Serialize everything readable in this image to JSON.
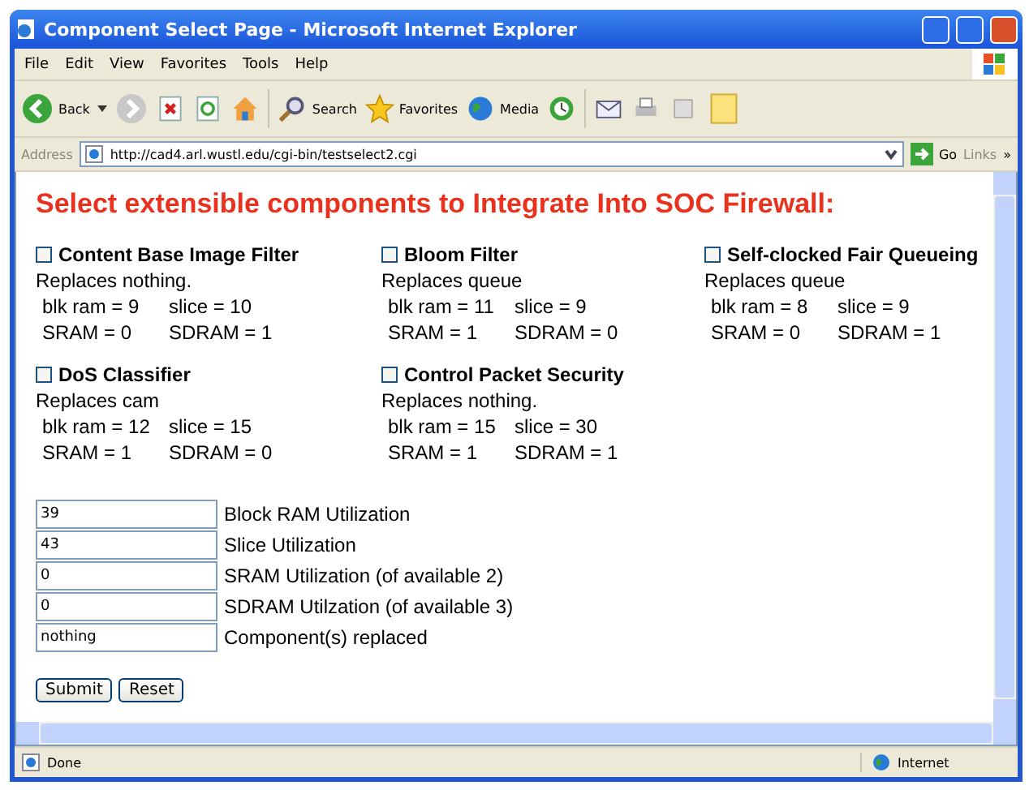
{
  "window": {
    "title": "Component Select Page - Microsoft Internet Explorer"
  },
  "menu": [
    "File",
    "Edit",
    "View",
    "Favorites",
    "Tools",
    "Help"
  ],
  "toolbar": {
    "back": "Back",
    "search": "Search",
    "favorites": "Favorites",
    "media": "Media"
  },
  "address_bar": {
    "label": "Address",
    "url": "http://cad4.arl.wustl.edu/cgi-bin/testselect2.cgi",
    "go": "Go",
    "links": "Links",
    "more": "»"
  },
  "heading": "Select extensible components to Integrate Into SOC Firewall:",
  "components": [
    {
      "name": "Content Base Image Filter",
      "checked": false,
      "replaces": "Replaces nothing.",
      "blk_ram": "blk ram = 9",
      "slice": "slice = 10",
      "sram": "SRAM = 0",
      "sdram": "SDRAM = 1"
    },
    {
      "name": "Bloom Filter",
      "checked": false,
      "replaces": "Replaces queue",
      "blk_ram": "blk ram = 11",
      "slice": "slice = 9",
      "sram": "SRAM = 1",
      "sdram": "SDRAM = 0"
    },
    {
      "name": "Self-clocked Fair Queueing",
      "checked": false,
      "replaces": "Replaces queue",
      "blk_ram": "blk ram = 8",
      "slice": "slice = 9",
      "sram": "SRAM = 0",
      "sdram": "SDRAM = 1"
    },
    {
      "name": "DoS Classifier",
      "checked": false,
      "replaces": "Replaces cam",
      "blk_ram": "blk ram = 12",
      "slice": "slice = 15",
      "sram": "SRAM = 1",
      "sdram": "SDRAM = 0"
    },
    {
      "name": "Control Packet Security",
      "checked": false,
      "replaces": "Replaces nothing.",
      "blk_ram": "blk ram = 15",
      "slice": "slice = 30",
      "sram": "SRAM = 1",
      "sdram": "SDRAM = 1"
    }
  ],
  "fields": [
    {
      "value": "39",
      "label": "Block RAM Utilization"
    },
    {
      "value": "43",
      "label": "Slice Utilization"
    },
    {
      "value": "0",
      "label": "SRAM Utilization (of available 2)"
    },
    {
      "value": "0",
      "label": "SDRAM Utilzation (of available 3)"
    },
    {
      "value": "nothing",
      "label": "Component(s) replaced"
    }
  ],
  "buttons": [
    "Submit",
    "Reset"
  ],
  "status_bar": {
    "text": "Done",
    "zone": "Internet"
  }
}
